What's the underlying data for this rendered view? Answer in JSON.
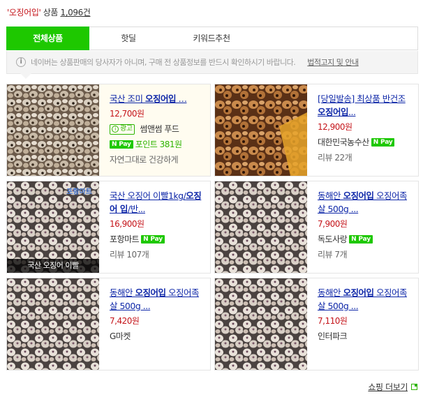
{
  "header": {
    "query": "'오징어입'",
    "label": "상품",
    "count": "1,096건"
  },
  "tabs": [
    {
      "label": "전체상품",
      "active": true
    },
    {
      "label": "핫딜",
      "active": false
    },
    {
      "label": "키워드추천",
      "active": false
    }
  ],
  "notice": {
    "text": "네이버는 상품판매의 당사자가 아니며, 구매 전 상품정보를 반드시 확인하시기 바랍니다.",
    "legal_link": "법적고지 및 안내"
  },
  "products": [
    {
      "title_pre": "국산 조미 ",
      "title_kw": "오징어입",
      "title_post": " …",
      "price": "12,700원",
      "ad_label": "광고",
      "seller": "썸앤썸 푸드",
      "npay": "N Pay",
      "points": "포인트 381원",
      "desc": "자연그대로 건강하게",
      "image": "dried-squid-mouth"
    },
    {
      "title_pre": "[당일발송] 최상품 반건조 ",
      "title_kw": "오징어입",
      "title_post": "...",
      "price": "12,900원",
      "seller": "대한민국농수산",
      "npay": "N Pay",
      "review": "리뷰 22개",
      "image": "roasted-squid-mouth"
    },
    {
      "title_pre": "국산 오징어 이빨1kg/",
      "title_kw": "오징어 입",
      "title_post": "/반...",
      "price": "16,900원",
      "seller": "포항마트",
      "npay": "N Pay",
      "review": "리뷰 107개",
      "image_caption": "국산 오징어 이빨",
      "image_logo": "포항마트",
      "image": "squid-teeth"
    },
    {
      "title_pre": "동해안 ",
      "title_kw": "오징어입",
      "title_post": " 오징어족살 500g ...",
      "price": "7,900원",
      "seller": "독도사랑",
      "npay": "N Pay",
      "review": "리뷰 7개",
      "image": "squid-mouth-pile"
    },
    {
      "title_pre": "동해안 ",
      "title_kw": "오징어입",
      "title_post": " 오징어족살 500g ...",
      "price": "7,420원",
      "seller": "G마켓",
      "image": "squid-mouth-pile"
    },
    {
      "title_pre": "동해안 ",
      "title_kw": "오징어입",
      "title_post": " 오징어족살 500g ...",
      "price": "7,110원",
      "seller": "인터파크",
      "image": "squid-mouth-pile"
    }
  ],
  "more_link": "쇼핑 더보기",
  "colors": {
    "accent_green": "#1ec800",
    "price_red": "#c5151b",
    "link_blue": "#0e27a8"
  }
}
